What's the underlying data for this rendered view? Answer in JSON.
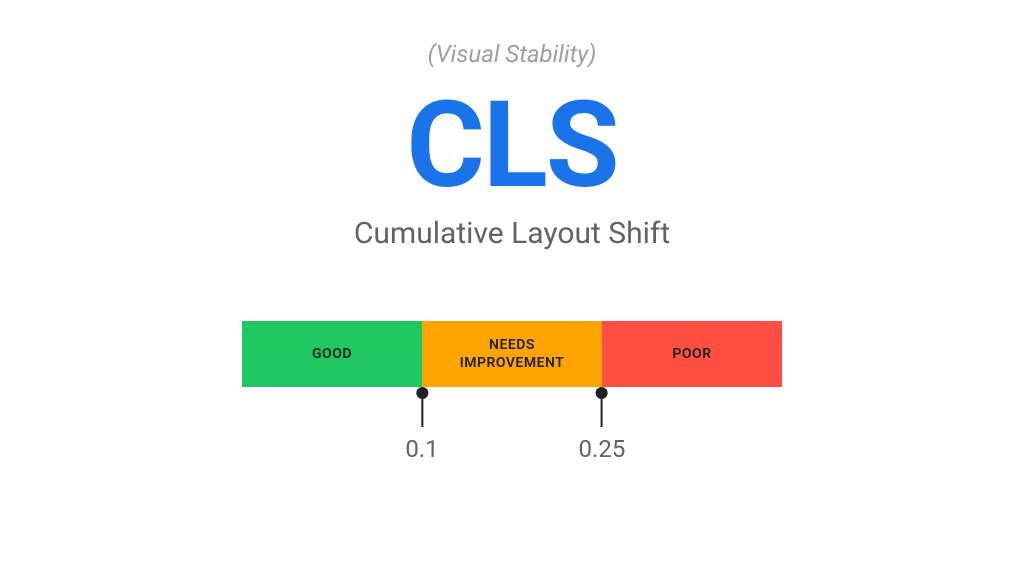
{
  "subtitle": "(Visual Stability)",
  "abbreviation": "CLS",
  "full_name": "Cumulative Layout Shift",
  "segments": {
    "good": "GOOD",
    "needs": "NEEDS\nIMPROVEMENT",
    "poor": "POOR"
  },
  "thresholds": {
    "first": "0.1",
    "second": "0.25"
  },
  "colors": {
    "good": "#1ec760",
    "needs": "#ffa400",
    "poor": "#ff4e42",
    "brand": "#1a73e8"
  },
  "chart_data": {
    "type": "bar",
    "title": "CLS — Cumulative Layout Shift (Visual Stability)",
    "categories": [
      "GOOD",
      "NEEDS IMPROVEMENT",
      "POOR"
    ],
    "thresholds": [
      0.1,
      0.25
    ],
    "ranges": [
      {
        "label": "GOOD",
        "min": 0,
        "max": 0.1,
        "color": "#1ec760"
      },
      {
        "label": "NEEDS IMPROVEMENT",
        "min": 0.1,
        "max": 0.25,
        "color": "#ffa400"
      },
      {
        "label": "POOR",
        "min": 0.25,
        "max": null,
        "color": "#ff4e42"
      }
    ]
  }
}
